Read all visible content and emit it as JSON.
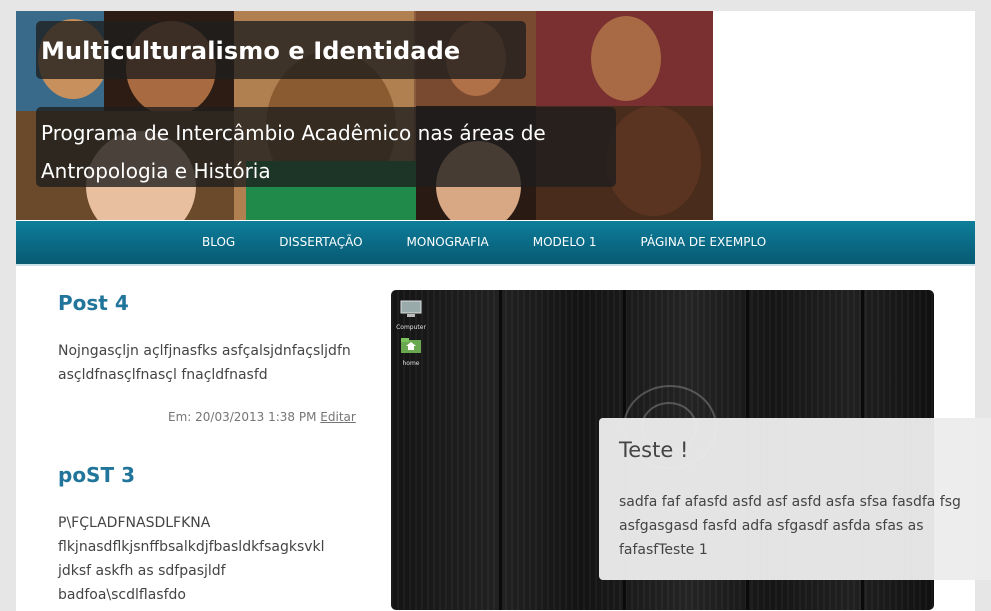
{
  "header": {
    "site_title": "Multiculturalismo e Identidade",
    "site_description": "Programa de Intercâmbio Acadêmico nas áreas de Antropologia e História"
  },
  "nav": {
    "items": [
      "BLOG",
      "DISSERTAÇÃO",
      "MONOGRAFIA",
      "MODELO 1",
      "PÁGINA DE EXEMPLO"
    ]
  },
  "posts": [
    {
      "title": "Post 4",
      "body": "Nojngasçljn açlfjnasfks asfçalsjdnfaçsljdfn asçldfnasçlfnasçl fnaçldfnasfd",
      "meta_prefix": "Em: 20/03/2013 1:38 PM",
      "edit_label": "Editar"
    },
    {
      "title": "poST 3",
      "body_lines": [
        "P\\FÇLADFNASDLFKNA",
        "flkjnasdflkjsnffbsalkdjfbasldkfsagksvkl",
        "jdksf askfh as sdfpasjldf",
        "badfoa\\scdlflasfdo"
      ]
    }
  ],
  "desktop": {
    "icons": [
      {
        "name": "computer-icon",
        "label": "Computer"
      },
      {
        "name": "home-folder-icon",
        "label": "home"
      }
    ]
  },
  "widget": {
    "title": "Teste !",
    "text": "sadfa faf afasfd asfd asf asfd asfa sfsa fasdfa fsg asfgasgasd fasfd adfa sfgasdf asfda sfas as fafasfTeste 1"
  },
  "colors": {
    "link_blue": "#21759b",
    "nav_bg": "#0a6985",
    "text": "#444444"
  }
}
